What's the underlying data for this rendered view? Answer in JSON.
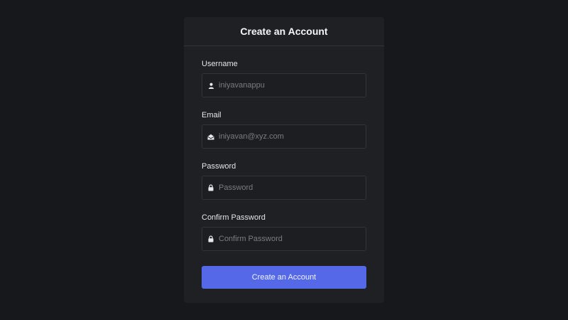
{
  "card": {
    "title": "Create an Account"
  },
  "form": {
    "username": {
      "label": "Username",
      "placeholder": "iniyavanappu",
      "icon": "user-icon"
    },
    "email": {
      "label": "Email",
      "placeholder": "iniyavan@xyz.com",
      "icon": "envelope-open-icon"
    },
    "password": {
      "label": "Password",
      "placeholder": "Password",
      "icon": "lock-icon"
    },
    "confirm_password": {
      "label": "Confirm Password",
      "placeholder": "Confirm Password",
      "icon": "lock-icon"
    },
    "submit_label": "Create an Account"
  },
  "colors": {
    "background": "#17181c",
    "card": "#1f2024",
    "accent": "#5468e8"
  }
}
